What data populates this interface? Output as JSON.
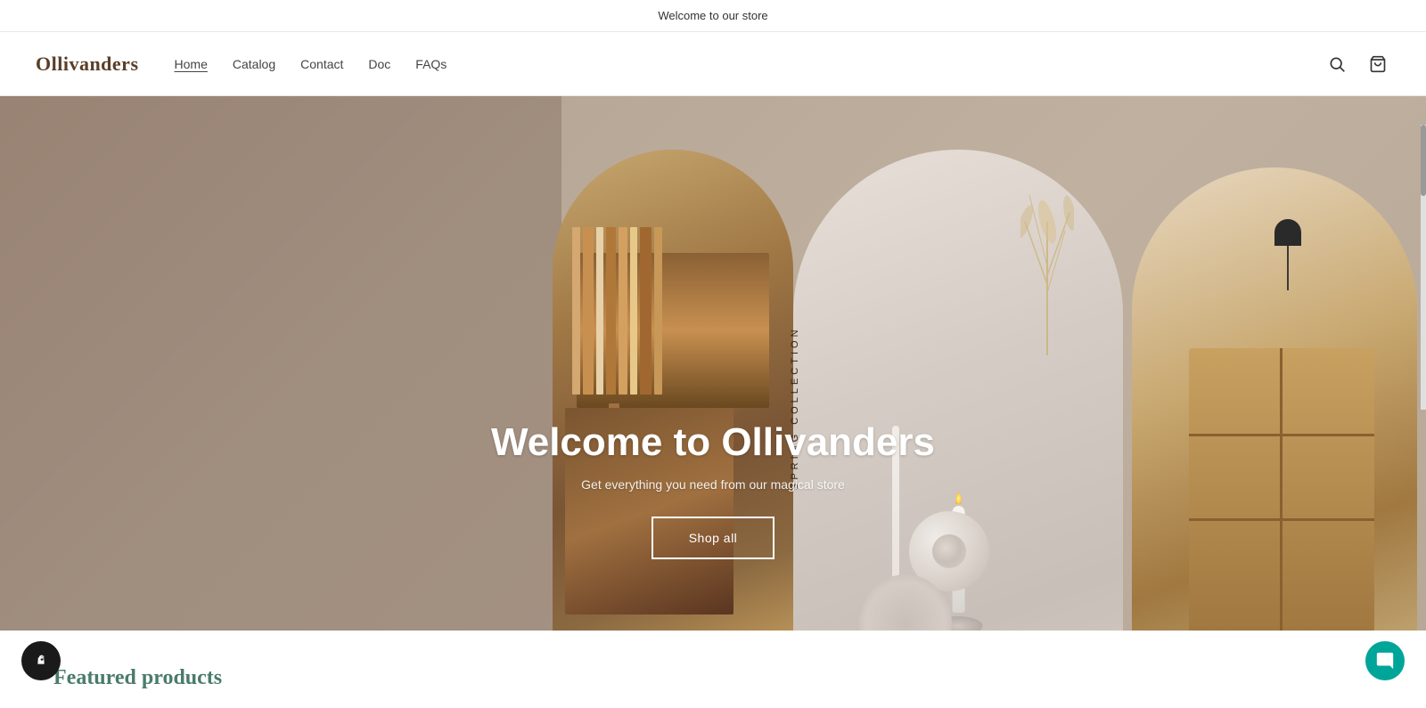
{
  "announcement": {
    "text": "Welcome to our store"
  },
  "header": {
    "logo": "Ollivanders",
    "nav": [
      {
        "label": "Home",
        "active": true
      },
      {
        "label": "Catalog",
        "active": false
      },
      {
        "label": "Contact",
        "active": false
      },
      {
        "label": "Doc",
        "active": false
      },
      {
        "label": "FAQs",
        "active": false
      }
    ]
  },
  "hero": {
    "title": "Welcome to Ollivanders",
    "subtitle": "Get everything you need from our magical store",
    "cta_label": "Shop all",
    "spring_text_1": "SPRING COLLECTION",
    "spring_text_2": "SPRING COLLECTION"
  },
  "featured": {
    "title": "Featured products"
  }
}
